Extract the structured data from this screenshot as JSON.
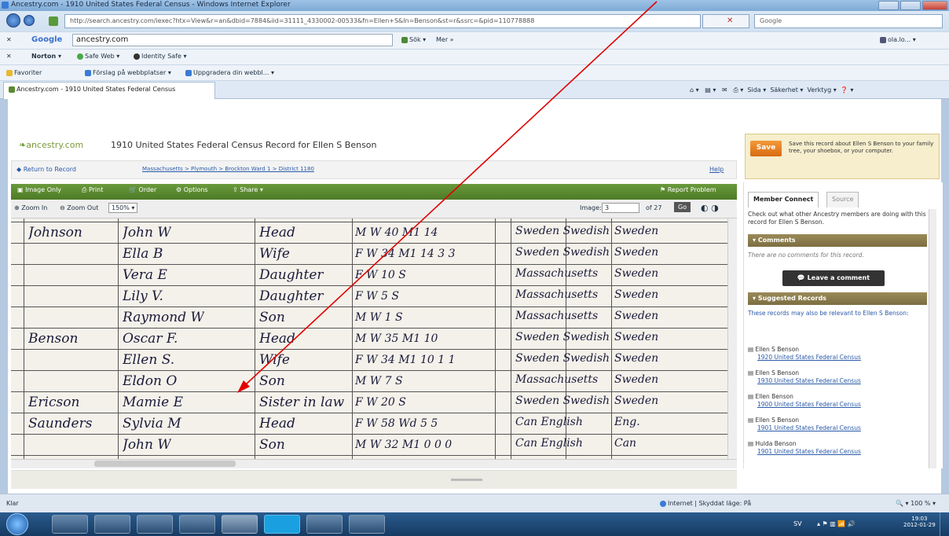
{
  "browser": {
    "window_title": "Ancestry.com - 1910 United States Federal Census - Windows Internet Explorer",
    "url": "http://search.ancestry.com/iexec?htx=View&r=an&dbid=7884&iid=31111_4330002-00533&fn=Ellen+S&ln=Benson&st=r&ssrc=&pid=110778888",
    "search_placeholder": "Google",
    "google_query": "ancestry.com",
    "google_search_label": "Sök",
    "google_more": "Mer »",
    "google_user": "ola.lo...",
    "norton_label": "Norton",
    "safe_web": "Safe Web",
    "identity_safe": "Identity Safe",
    "favorites_label": "Favoriter",
    "fav_suggested": "Förslag på webbplatser",
    "fav_upgrade": "Uppgradera din webbl...",
    "tab_title": "Ancestry.com - 1910 United States Federal Census",
    "cmd_page": "Sida",
    "cmd_safety": "Säkerhet",
    "cmd_tools": "Verktyg",
    "status_left": "Klar",
    "status_zone": "Internet | Skyddat läge: På",
    "status_zoom": "100 %"
  },
  "page": {
    "logo": "ancestry.com",
    "title": "1910 United States Federal Census Record for Ellen S Benson",
    "return_link": "Return to Record",
    "breadcrumb": "Massachusetts > Plymouth > Brockton Ward 1 > District 1180",
    "help": "Help",
    "save_button": "Save",
    "save_text": "Save this record about Ellen S Benson to your family tree, your shoebox, or your computer."
  },
  "toolbar": {
    "image_only": "Image Only",
    "print": "Print",
    "order": "Order",
    "options": "Options",
    "share": "Share",
    "report_problem": "Report Problem"
  },
  "zoom": {
    "zoom_in": "Zoom In",
    "zoom_out": "Zoom Out",
    "level": "150%",
    "image_label": "Image:",
    "image_number": "3",
    "of_total": "of 27",
    "go": "Go"
  },
  "sidebar": {
    "tab_member_connect": "Member Connect",
    "tab_source": "Source",
    "intro": "Check out what other Ancestry members are doing with this record for Ellen S Benson.",
    "comments_header": "Comments",
    "no_comments": "There are no comments for this record.",
    "leave_comment": "Leave a comment",
    "suggested_header": "Suggested Records",
    "suggested_intro": "These records may also be relevant to Ellen S Benson:",
    "records": [
      {
        "name": "Ellen S Benson",
        "link": "1920 United States Federal Census"
      },
      {
        "name": "Ellen S Benson",
        "link": "1930 United States Federal Census"
      },
      {
        "name": "Ellen Benson",
        "link": "1900 United States Federal Census"
      },
      {
        "name": "Ellen S Benson",
        "link": "1901 United States Federal Census"
      },
      {
        "name": "Hulda Benson",
        "link": "1901 United States Federal Census"
      }
    ]
  },
  "census_rows": [
    {
      "surname": "Johnson",
      "given": "John W",
      "relation": "Head",
      "sex_race_age": "M W 40 M1 14",
      "birthplace": "Sweden Swedish",
      "parents": "Sweden"
    },
    {
      "surname": "",
      "given": "Ella B",
      "relation": "Wife",
      "sex_race_age": "F W 34 M1 14 3 3",
      "birthplace": "Sweden Swedish",
      "parents": "Sweden"
    },
    {
      "surname": "",
      "given": "Vera E",
      "relation": "Daughter",
      "sex_race_age": "F W 10 S",
      "birthplace": "Massachusetts",
      "parents": "Sweden"
    },
    {
      "surname": "",
      "given": "Lily V.",
      "relation": "Daughter",
      "sex_race_age": "F W 5 S",
      "birthplace": "Massachusetts",
      "parents": "Sweden"
    },
    {
      "surname": "",
      "given": "Raymond W",
      "relation": "Son",
      "sex_race_age": "M W 1 S",
      "birthplace": "Massachusetts",
      "parents": "Sweden"
    },
    {
      "surname": "Benson",
      "given": "Oscar F.",
      "relation": "Head",
      "sex_race_age": "M W 35 M1 10",
      "birthplace": "Sweden Swedish",
      "parents": "Sweden"
    },
    {
      "surname": "",
      "given": "Ellen S.",
      "relation": "Wife",
      "sex_race_age": "F W 34 M1 10 1 1",
      "birthplace": "Sweden Swedish",
      "parents": "Sweden"
    },
    {
      "surname": "",
      "given": "Eldon O",
      "relation": "Son",
      "sex_race_age": "M W 7 S",
      "birthplace": "Massachusetts",
      "parents": "Sweden"
    },
    {
      "surname": "Ericson",
      "given": "Mamie E",
      "relation": "Sister in law",
      "sex_race_age": "F W 20 S",
      "birthplace": "Sweden Swedish",
      "parents": "Sweden"
    },
    {
      "surname": "Saunders",
      "given": "Sylvia M",
      "relation": "Head",
      "sex_race_age": "F W 58 Wd 5 5",
      "birthplace": "Can English",
      "parents": "Eng."
    },
    {
      "surname": "",
      "given": "John W",
      "relation": "Son",
      "sex_race_age": "M W 32 M1 0 0 0",
      "birthplace": "Can English",
      "parents": "Can"
    }
  ],
  "taskbar": {
    "language": "SV",
    "time": "19:03",
    "date": "2012-01-29"
  },
  "colors": {
    "ancestry_green": "#5a8a30",
    "annotation_arrow": "#e00000",
    "save_orange": "#e98020"
  }
}
